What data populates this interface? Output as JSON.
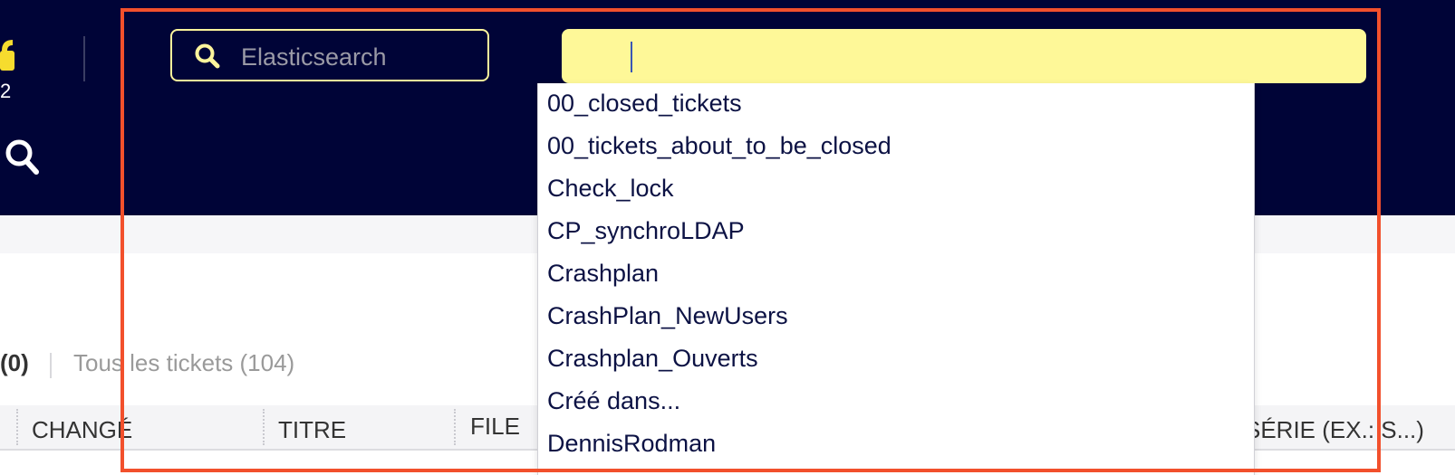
{
  "app": {
    "lock_count": "2"
  },
  "header": {
    "search_placeholder": "Elasticsearch",
    "query_value": ""
  },
  "filters": {
    "mine_count": "(0)",
    "all_tickets": "Tous les tickets (104)"
  },
  "table": {
    "columns": [
      "CHANGÉ",
      "TITRE",
      "FILE",
      "SÉRIE (EX.: S...)"
    ]
  },
  "dropdown": {
    "options": [
      "00_closed_tickets",
      "00_tickets_about_to_be_closed",
      "Check_lock",
      "CP_synchroLDAP",
      "Crashplan",
      "CrashPlan_NewUsers",
      "Crashplan_Ouverts",
      "Créé dans...",
      "DennisRodman"
    ]
  },
  "colors": {
    "header_bg": "#000437",
    "accent_yellow": "#fef898",
    "highlight": "#f2502c"
  }
}
